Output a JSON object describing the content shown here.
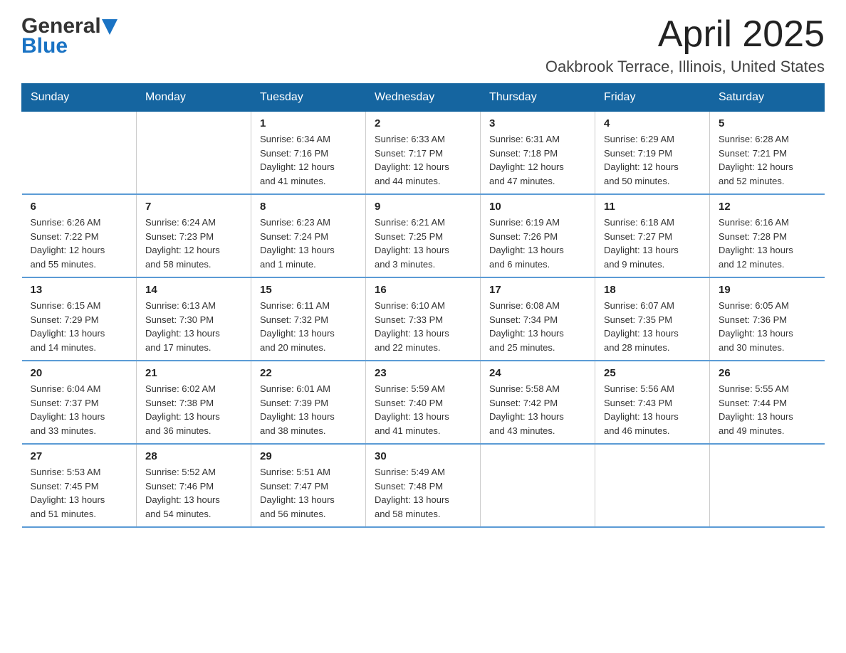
{
  "header": {
    "title": "April 2025",
    "subtitle": "Oakbrook Terrace, Illinois, United States",
    "logo_general": "General",
    "logo_blue": "Blue"
  },
  "weekdays": [
    "Sunday",
    "Monday",
    "Tuesday",
    "Wednesday",
    "Thursday",
    "Friday",
    "Saturday"
  ],
  "weeks": [
    [
      {
        "day": "",
        "info": ""
      },
      {
        "day": "",
        "info": ""
      },
      {
        "day": "1",
        "info": "Sunrise: 6:34 AM\nSunset: 7:16 PM\nDaylight: 12 hours\nand 41 minutes."
      },
      {
        "day": "2",
        "info": "Sunrise: 6:33 AM\nSunset: 7:17 PM\nDaylight: 12 hours\nand 44 minutes."
      },
      {
        "day": "3",
        "info": "Sunrise: 6:31 AM\nSunset: 7:18 PM\nDaylight: 12 hours\nand 47 minutes."
      },
      {
        "day": "4",
        "info": "Sunrise: 6:29 AM\nSunset: 7:19 PM\nDaylight: 12 hours\nand 50 minutes."
      },
      {
        "day": "5",
        "info": "Sunrise: 6:28 AM\nSunset: 7:21 PM\nDaylight: 12 hours\nand 52 minutes."
      }
    ],
    [
      {
        "day": "6",
        "info": "Sunrise: 6:26 AM\nSunset: 7:22 PM\nDaylight: 12 hours\nand 55 minutes."
      },
      {
        "day": "7",
        "info": "Sunrise: 6:24 AM\nSunset: 7:23 PM\nDaylight: 12 hours\nand 58 minutes."
      },
      {
        "day": "8",
        "info": "Sunrise: 6:23 AM\nSunset: 7:24 PM\nDaylight: 13 hours\nand 1 minute."
      },
      {
        "day": "9",
        "info": "Sunrise: 6:21 AM\nSunset: 7:25 PM\nDaylight: 13 hours\nand 3 minutes."
      },
      {
        "day": "10",
        "info": "Sunrise: 6:19 AM\nSunset: 7:26 PM\nDaylight: 13 hours\nand 6 minutes."
      },
      {
        "day": "11",
        "info": "Sunrise: 6:18 AM\nSunset: 7:27 PM\nDaylight: 13 hours\nand 9 minutes."
      },
      {
        "day": "12",
        "info": "Sunrise: 6:16 AM\nSunset: 7:28 PM\nDaylight: 13 hours\nand 12 minutes."
      }
    ],
    [
      {
        "day": "13",
        "info": "Sunrise: 6:15 AM\nSunset: 7:29 PM\nDaylight: 13 hours\nand 14 minutes."
      },
      {
        "day": "14",
        "info": "Sunrise: 6:13 AM\nSunset: 7:30 PM\nDaylight: 13 hours\nand 17 minutes."
      },
      {
        "day": "15",
        "info": "Sunrise: 6:11 AM\nSunset: 7:32 PM\nDaylight: 13 hours\nand 20 minutes."
      },
      {
        "day": "16",
        "info": "Sunrise: 6:10 AM\nSunset: 7:33 PM\nDaylight: 13 hours\nand 22 minutes."
      },
      {
        "day": "17",
        "info": "Sunrise: 6:08 AM\nSunset: 7:34 PM\nDaylight: 13 hours\nand 25 minutes."
      },
      {
        "day": "18",
        "info": "Sunrise: 6:07 AM\nSunset: 7:35 PM\nDaylight: 13 hours\nand 28 minutes."
      },
      {
        "day": "19",
        "info": "Sunrise: 6:05 AM\nSunset: 7:36 PM\nDaylight: 13 hours\nand 30 minutes."
      }
    ],
    [
      {
        "day": "20",
        "info": "Sunrise: 6:04 AM\nSunset: 7:37 PM\nDaylight: 13 hours\nand 33 minutes."
      },
      {
        "day": "21",
        "info": "Sunrise: 6:02 AM\nSunset: 7:38 PM\nDaylight: 13 hours\nand 36 minutes."
      },
      {
        "day": "22",
        "info": "Sunrise: 6:01 AM\nSunset: 7:39 PM\nDaylight: 13 hours\nand 38 minutes."
      },
      {
        "day": "23",
        "info": "Sunrise: 5:59 AM\nSunset: 7:40 PM\nDaylight: 13 hours\nand 41 minutes."
      },
      {
        "day": "24",
        "info": "Sunrise: 5:58 AM\nSunset: 7:42 PM\nDaylight: 13 hours\nand 43 minutes."
      },
      {
        "day": "25",
        "info": "Sunrise: 5:56 AM\nSunset: 7:43 PM\nDaylight: 13 hours\nand 46 minutes."
      },
      {
        "day": "26",
        "info": "Sunrise: 5:55 AM\nSunset: 7:44 PM\nDaylight: 13 hours\nand 49 minutes."
      }
    ],
    [
      {
        "day": "27",
        "info": "Sunrise: 5:53 AM\nSunset: 7:45 PM\nDaylight: 13 hours\nand 51 minutes."
      },
      {
        "day": "28",
        "info": "Sunrise: 5:52 AM\nSunset: 7:46 PM\nDaylight: 13 hours\nand 54 minutes."
      },
      {
        "day": "29",
        "info": "Sunrise: 5:51 AM\nSunset: 7:47 PM\nDaylight: 13 hours\nand 56 minutes."
      },
      {
        "day": "30",
        "info": "Sunrise: 5:49 AM\nSunset: 7:48 PM\nDaylight: 13 hours\nand 58 minutes."
      },
      {
        "day": "",
        "info": ""
      },
      {
        "day": "",
        "info": ""
      },
      {
        "day": "",
        "info": ""
      }
    ]
  ]
}
